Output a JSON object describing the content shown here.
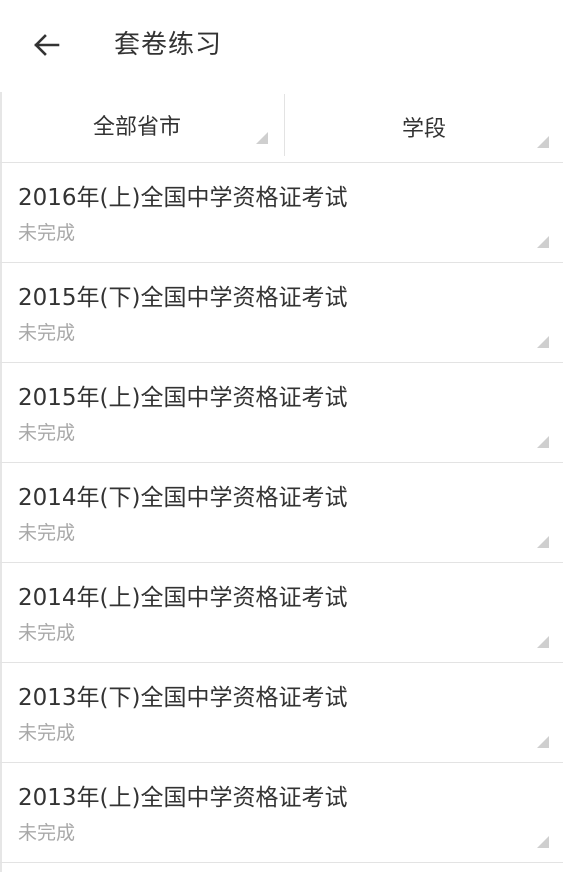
{
  "header": {
    "back_icon": "arrow-left-icon",
    "title": "套卷练习"
  },
  "filters": {
    "region_label": "全部省市",
    "stage_label": "学段",
    "dropdown_icon": "corner-triangle-icon"
  },
  "papers": [
    {
      "title": "2016年(上)全国中学资格证考试",
      "status": "未完成"
    },
    {
      "title": "2015年(下)全国中学资格证考试",
      "status": "未完成"
    },
    {
      "title": "2015年(上)全国中学资格证考试",
      "status": "未完成"
    },
    {
      "title": "2014年(下)全国中学资格证考试",
      "status": "未完成"
    },
    {
      "title": "2014年(上)全国中学资格证考试",
      "status": "未完成"
    },
    {
      "title": "2013年(下)全国中学资格证考试",
      "status": "未完成"
    },
    {
      "title": "2013年(上)全国中学资格证考试",
      "status": "未完成"
    }
  ],
  "colors": {
    "text_primary": "#333333",
    "text_secondary": "#a8a8a8",
    "divider": "#e3e3e3",
    "triangle": "#cfcfcf"
  }
}
